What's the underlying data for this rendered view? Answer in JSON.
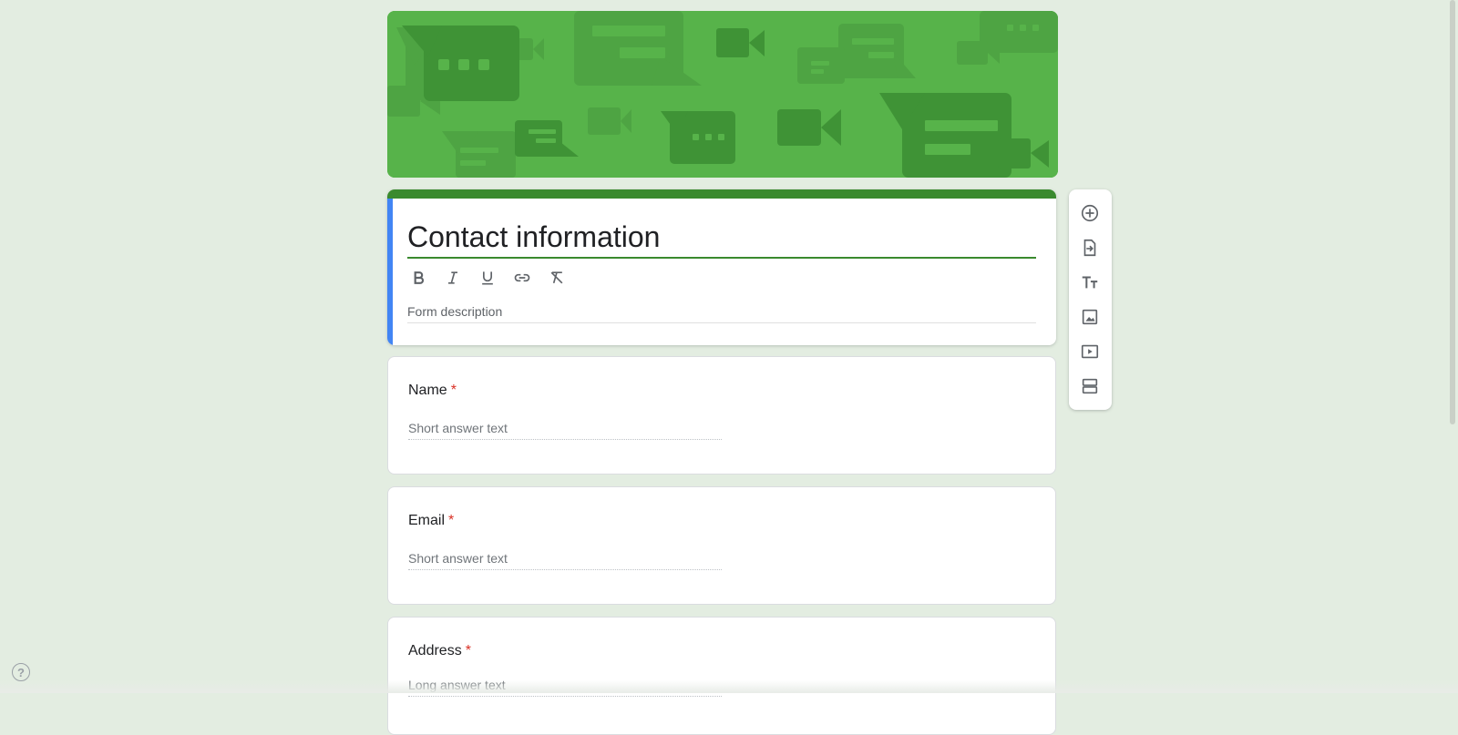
{
  "form": {
    "title": "Contact information",
    "description_placeholder": "Form description"
  },
  "formatting_toolbar": [
    "bold-icon",
    "italic-icon",
    "underline-icon",
    "link-icon",
    "clear-formatting-icon"
  ],
  "questions": [
    {
      "title": "Name",
      "required_mark": "*",
      "answer_placeholder": "Short answer text"
    },
    {
      "title": "Email",
      "required_mark": "*",
      "answer_placeholder": "Short answer text"
    },
    {
      "title": "Address",
      "required_mark": "*",
      "answer_placeholder": "Long answer text"
    }
  ],
  "side_toolbar": [
    "add-question-icon",
    "import-questions-icon",
    "add-title-icon",
    "add-image-icon",
    "add-video-icon",
    "add-section-icon"
  ],
  "help": {
    "label": "?"
  },
  "colors": {
    "background": "#e3ede1",
    "theme_dark": "#3a8a2e",
    "banner": "#57b34a",
    "focus_accent": "#4285f4",
    "required": "#d93025"
  }
}
